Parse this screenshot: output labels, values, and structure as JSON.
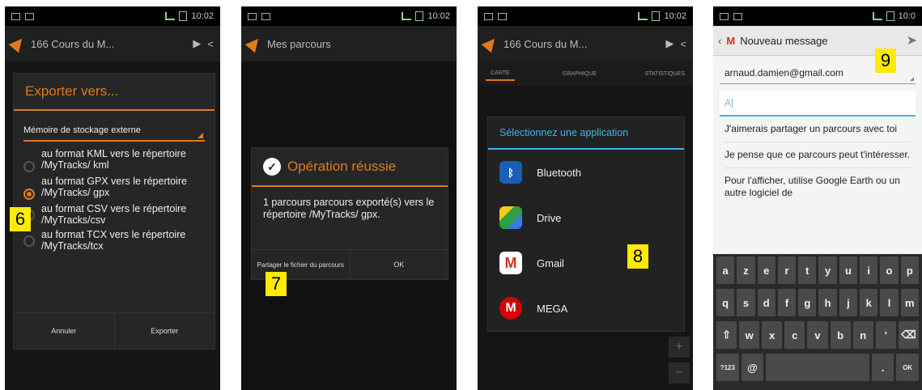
{
  "status": {
    "time": "10:02",
    "time_partial": "10:0"
  },
  "screen1": {
    "appbar_title": "166 Cours du M...",
    "dialog_title": "Exporter vers...",
    "storage_select": "Mémoire de stockage externe",
    "options": [
      "au format KML vers le répertoire /MyTracks/ kml",
      "au format GPX vers le répertoire /MyTracks/ gpx",
      "au format CSV vers le répertoire /MyTracks/csv",
      "au format TCX vers le répertoire /MyTracks/tcx"
    ],
    "selected_index": 1,
    "cancel_label": "Annuler",
    "export_label": "Exporter",
    "badge": "6"
  },
  "screen2": {
    "appbar_title": "Mes parcours",
    "dialog_title": "Opération réussie",
    "message": "1 parcours parcours exporté(s) vers le répertoire /MyTracks/ gpx.",
    "share_label": "Partager le fichier du parcours",
    "ok_label": "OK",
    "badge": "7"
  },
  "screen3": {
    "appbar_title": "166 Cours du M...",
    "tabs": [
      "CARTE",
      "GRAPHIQUE",
      "STATISTIQUES"
    ],
    "dialog_title": "Sélectionnez une application",
    "apps": [
      {
        "label": "Bluetooth",
        "icon": "bluetooth-icon",
        "color": "#1a5fb4"
      },
      {
        "label": "Drive",
        "icon": "drive-icon",
        "color": "#2f9e44"
      },
      {
        "label": "Gmail",
        "icon": "gmail-icon",
        "color": "#d93025"
      },
      {
        "label": "MEGA",
        "icon": "mega-icon",
        "color": "#d90007"
      }
    ],
    "badge": "8"
  },
  "screen4": {
    "appbar_title": "Nouveau message",
    "to": "arnaud.damien@gmail.com",
    "subject": "A",
    "body_lines": [
      "J'aimerais partager un parcours avec toi",
      "Je pense que ce parcours peut t'intéresser.",
      "Pour l'afficher, utilise Google Earth ou un autre logiciel de"
    ],
    "keys_row1": [
      "a",
      "z",
      "e",
      "r",
      "t",
      "y",
      "u",
      "i",
      "o",
      "p"
    ],
    "keys_row2": [
      "q",
      "s",
      "d",
      "f",
      "g",
      "h",
      "j",
      "k",
      "l",
      "m"
    ],
    "keys_row3": [
      "w",
      "x",
      "c",
      "v",
      "b",
      "n",
      "'"
    ],
    "key_123": "?123",
    "key_at": "@",
    "key_ok": "OK",
    "badge": "9"
  }
}
